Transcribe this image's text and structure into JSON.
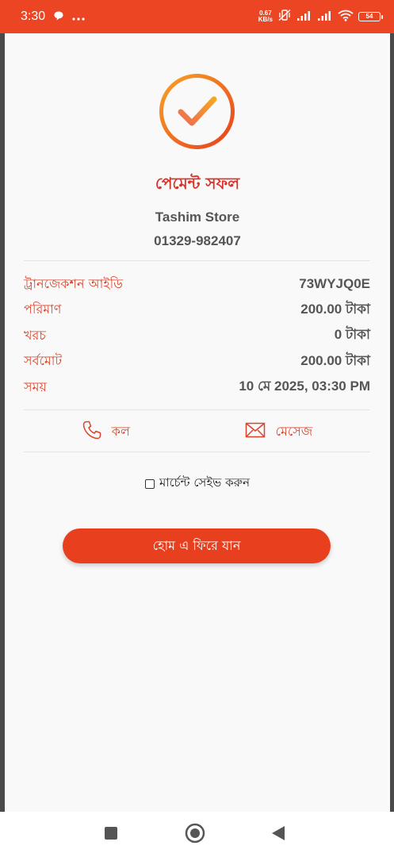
{
  "status_bar": {
    "time": "3:30",
    "net_speed_value": "0.67",
    "net_speed_unit": "KB/s",
    "battery": "54",
    "accent": "#ec4524"
  },
  "receipt": {
    "title": "পেমেন্ট সফল",
    "merchant_name": "Tashim Store",
    "merchant_phone": "01329-982407",
    "details": [
      {
        "label": "ট্রানজেকশন আইডি",
        "value": "73WYJQ0E"
      },
      {
        "label": "পরিমাণ",
        "value": "200.00 টাকা"
      },
      {
        "label": "খরচ",
        "value": "0 টাকা"
      },
      {
        "label": "সর্বমোট",
        "value": "200.00 টাকা"
      },
      {
        "label": "সময়",
        "value": "10 মে 2025, 03:30 PM"
      }
    ],
    "actions": {
      "call_label": "কল",
      "message_label": "মেসেজ"
    },
    "save_merchant_label": "মার্চেন্ট সেইভ করুন",
    "save_merchant_checked": false,
    "home_button_label": "হোম এ ফিরে যান"
  },
  "icons": {
    "status_chat": "chat-bubble-icon",
    "status_more": "more-dots-icon",
    "vibrate_off": "vibrate-off-icon",
    "signal1": "signal-icon",
    "signal2": "signal-icon",
    "wifi": "wifi-icon",
    "success": "checkmark-circle-icon",
    "call": "phone-icon",
    "message": "envelope-icon",
    "nav_recent": "square-icon",
    "nav_home": "circle-icon",
    "nav_back": "back-triangle-icon"
  },
  "colors": {
    "brand": "#e8401f",
    "label_red": "#d9442c",
    "gradient_start": "#f5a623",
    "gradient_end": "#e8401f"
  }
}
